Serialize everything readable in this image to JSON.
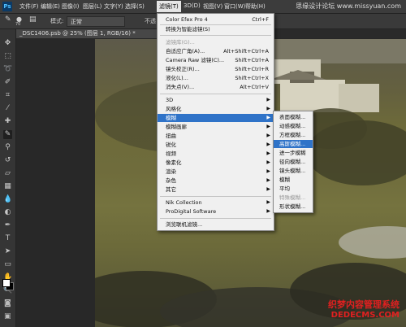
{
  "menubar": {
    "logo": "Ps",
    "items": [
      "文件(F)",
      "编辑(E)",
      "图像(I)",
      "图层(L)",
      "文字(Y)",
      "选择(S)",
      "滤镜(T)",
      "3D(D)",
      "视图(V)",
      "窗口(W)",
      "帮助(H)"
    ],
    "watermark": "思缘设计论坛 www.missyuan.com",
    "window_controls": "— ☐ ✕"
  },
  "options_bar": {
    "brush_size": "70",
    "mode_label": "模式:",
    "mode_value": "正常",
    "opacity_label": "不透"
  },
  "document_tab": {
    "title": "_DSC1406.psb @ 25% (图层 1, RGB/16) *"
  },
  "filter_menu": {
    "top": [
      {
        "label": "Color Efex Pro 4",
        "shortcut": "Ctrl+F"
      },
      {
        "label": "转换为智能滤镜(S)",
        "shortcut": ""
      }
    ],
    "group2": [
      {
        "label": "滤镜库(G)...",
        "shortcut": "",
        "disabled": true
      },
      {
        "label": "自适应广角(A)...",
        "shortcut": "Alt+Shift+Ctrl+A"
      },
      {
        "label": "Camera Raw 滤镜(C)...",
        "shortcut": "Shift+Ctrl+A"
      },
      {
        "label": "镜头校正(R)...",
        "shortcut": "Shift+Ctrl+R"
      },
      {
        "label": "液化(L)...",
        "shortcut": "Shift+Ctrl+X"
      },
      {
        "label": "消失点(V)...",
        "shortcut": "Alt+Ctrl+V"
      }
    ],
    "group3": [
      {
        "label": "3D",
        "submenu": true
      },
      {
        "label": "风格化",
        "submenu": true
      },
      {
        "label": "模糊",
        "submenu": true,
        "highlighted": true
      },
      {
        "label": "模糊画廊",
        "submenu": true
      },
      {
        "label": "扭曲",
        "submenu": true
      },
      {
        "label": "锐化",
        "submenu": true
      },
      {
        "label": "视频",
        "submenu": true
      },
      {
        "label": "像素化",
        "submenu": true
      },
      {
        "label": "渲染",
        "submenu": true
      },
      {
        "label": "杂色",
        "submenu": true
      },
      {
        "label": "其它",
        "submenu": true
      }
    ],
    "group4": [
      {
        "label": "Nik Collection",
        "submenu": true
      },
      {
        "label": "ProDigital Software",
        "submenu": true
      }
    ],
    "bottom": [
      {
        "label": "浏览联机滤镜..."
      }
    ]
  },
  "blur_submenu": {
    "items": [
      {
        "label": "表面模糊...",
        "disabled": false
      },
      {
        "label": "动感模糊...",
        "disabled": false
      },
      {
        "label": "方框模糊...",
        "disabled": false
      },
      {
        "label": "高斯模糊...",
        "disabled": false,
        "highlighted": true
      },
      {
        "label": "进一步模糊",
        "disabled": false
      },
      {
        "label": "径向模糊...",
        "disabled": false
      },
      {
        "label": "镜头模糊...",
        "disabled": false
      },
      {
        "label": "模糊",
        "disabled": false
      },
      {
        "label": "平均",
        "disabled": false
      },
      {
        "label": "特殊模糊...",
        "disabled": true
      },
      {
        "label": "形状模糊...",
        "disabled": false
      }
    ]
  },
  "watermarks": {
    "line1": "织梦内容管理系统",
    "line2": "DEDECMS.COM"
  },
  "colors": {
    "highlight": "#2f73c8",
    "menu_bg": "#f0f0f0",
    "ui_dark": "#353535"
  }
}
